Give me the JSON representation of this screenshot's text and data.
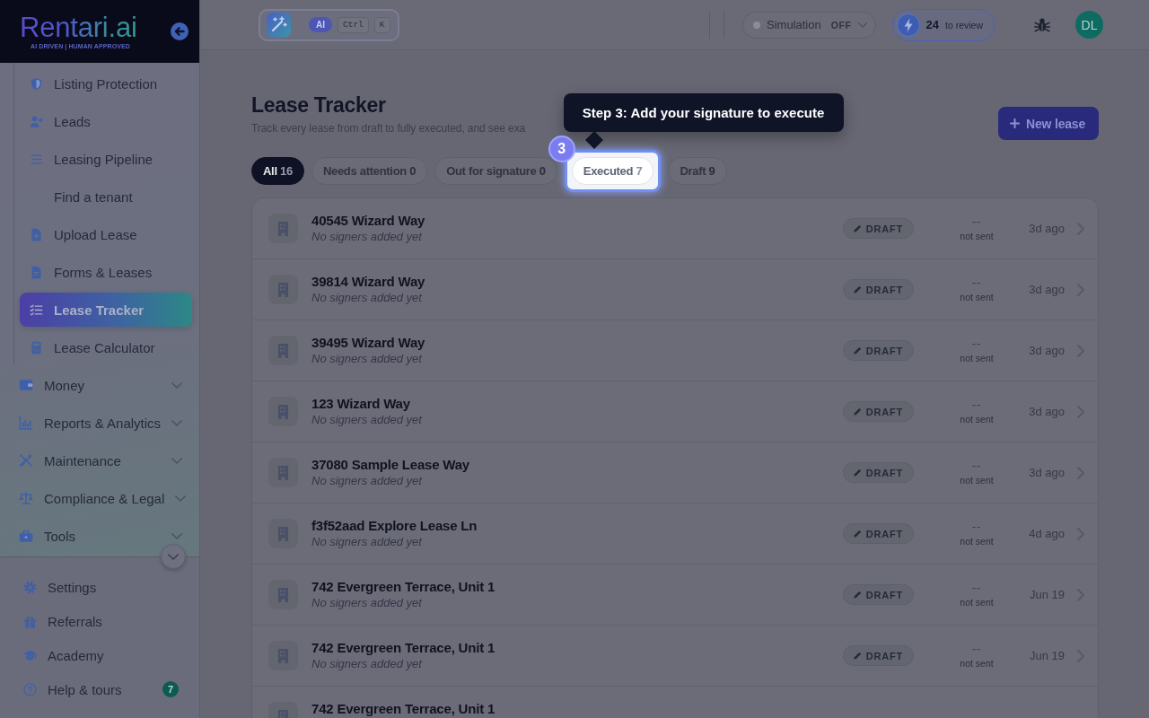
{
  "sidebar": {
    "logo": {
      "wordmark": "Rentari.ai",
      "tagline": "AI DRIVEN | HUMAN APPROVED"
    },
    "items": [
      {
        "label": "Listing Protection",
        "selected": false
      },
      {
        "label": "Leads",
        "selected": false
      },
      {
        "label": "Leasing Pipeline",
        "selected": false
      },
      {
        "label": "Find a tenant",
        "selected": false
      },
      {
        "label": "Upload Lease",
        "selected": false
      },
      {
        "label": "Forms & Leases",
        "selected": false
      },
      {
        "label": "Lease Tracker",
        "selected": true
      },
      {
        "label": "Lease Calculator",
        "selected": false
      }
    ],
    "groups": [
      {
        "label": "Money",
        "expanded": false
      },
      {
        "label": "Reports & Analytics",
        "expanded": false
      },
      {
        "label": "Maintenance",
        "expanded": false
      },
      {
        "label": "Compliance & Legal",
        "expanded": false
      },
      {
        "label": "Tools",
        "expanded": false
      }
    ],
    "footer_items": [
      {
        "label": "Settings"
      },
      {
        "label": "Referrals"
      },
      {
        "label": "Academy"
      },
      {
        "label": "Help & tours",
        "badge": "7"
      }
    ]
  },
  "top_bar": {
    "command": {
      "ai_tag": "AI",
      "keys": [
        "Ctrl",
        "K"
      ]
    },
    "simulation": {
      "label": "Simulation",
      "state": "OFF",
      "on": false
    },
    "review": {
      "count": "24",
      "label": "to review"
    },
    "avatar": {
      "initials": "DL"
    }
  },
  "page": {
    "title": "Lease Tracker",
    "subtitle": "Track every lease from draft to fully executed, and see exa",
    "new_button": "New lease",
    "tabs": [
      {
        "label": "All",
        "count": "16",
        "selected": true,
        "highlighted": false
      },
      {
        "label": "Needs attention",
        "count": "0",
        "selected": false,
        "highlighted": false
      },
      {
        "label": "Out for signature",
        "count": "0",
        "selected": false,
        "highlighted": false
      },
      {
        "label": "Executed",
        "count": "7",
        "selected": false,
        "highlighted": true
      },
      {
        "label": "Draft",
        "count": "9",
        "selected": false,
        "highlighted": false
      }
    ],
    "tour": {
      "step": "3",
      "text": "Step 3: Add your signature to execute"
    },
    "rows": [
      {
        "title": "40545 Wizard Way",
        "subtitle": "No signers added yet",
        "status": "DRAFT",
        "signers": "--",
        "sent": "not sent",
        "date": "3d ago"
      },
      {
        "title": "39814 Wizard Way",
        "subtitle": "No signers added yet",
        "status": "DRAFT",
        "signers": "--",
        "sent": "not sent",
        "date": "3d ago"
      },
      {
        "title": "39495 Wizard Way",
        "subtitle": "No signers added yet",
        "status": "DRAFT",
        "signers": "--",
        "sent": "not sent",
        "date": "3d ago"
      },
      {
        "title": "123 Wizard Way",
        "subtitle": "No signers added yet",
        "status": "DRAFT",
        "signers": "--",
        "sent": "not sent",
        "date": "3d ago"
      },
      {
        "title": "37080 Sample Lease Way",
        "subtitle": "No signers added yet",
        "status": "DRAFT",
        "signers": "--",
        "sent": "not sent",
        "date": "3d ago"
      },
      {
        "title": "f3f52aad Explore Lease Ln",
        "subtitle": "No signers added yet",
        "status": "DRAFT",
        "signers": "--",
        "sent": "not sent",
        "date": "4d ago"
      },
      {
        "title": "742 Evergreen Terrace, Unit 1",
        "subtitle": "No signers added yet",
        "status": "DRAFT",
        "signers": "--",
        "sent": "not sent",
        "date": "Jun 19"
      },
      {
        "title": "742 Evergreen Terrace, Unit 1",
        "subtitle": "No signers added yet",
        "status": "DRAFT",
        "signers": "--",
        "sent": "not sent",
        "date": "Jun 19"
      },
      {
        "title": "742 Evergreen Terrace, Unit 1"
      }
    ]
  }
}
